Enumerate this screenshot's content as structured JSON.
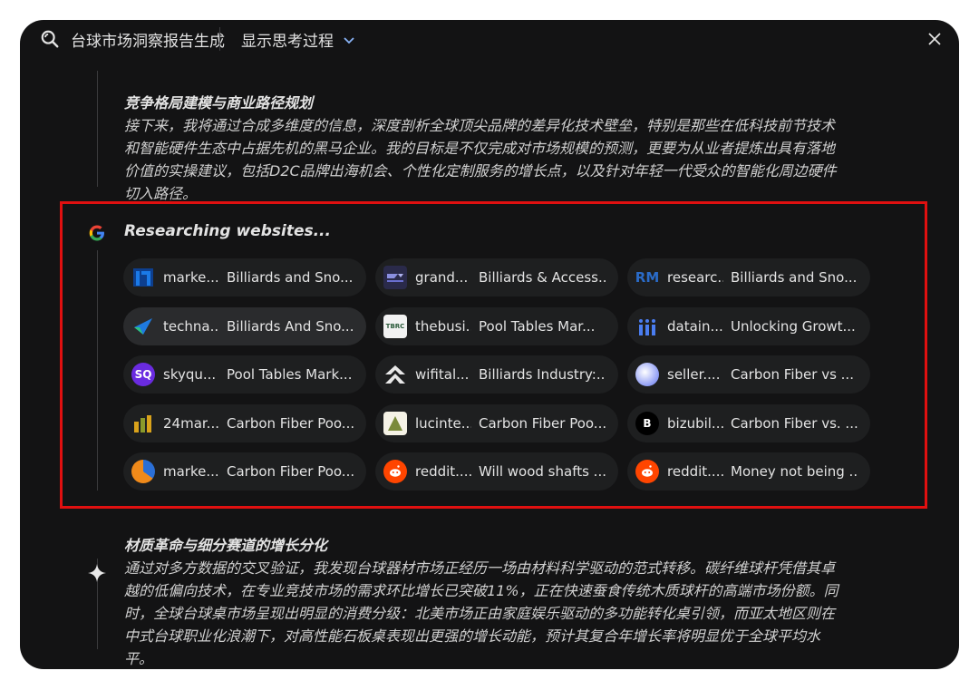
{
  "header": {
    "app_title": "台球市场洞察报告生成",
    "thinking_toggle": "显示思考过程",
    "close_label": "×"
  },
  "section1": {
    "title": "竞争格局建模与商业路径规划",
    "lines": [
      "接下来，我将通过合成多维度的信息，深度剖析全球顶尖品牌的差异化技术壁垒，特别是那些在低科技前节技术",
      "和智能硬件生态中占据先机的黑马企业。我的目标是不仅完成对市场规模的预测，更要为从业者提炼出具有落地",
      "价值的实操建议，包括D2C品牌出海机会、个性化定制服务的增长点，以及针对年轻一代受众的智能化周边硬件",
      "切入路径。"
    ]
  },
  "research": {
    "label": "Researching websites...",
    "chips": [
      {
        "site": "marke...",
        "title": "Billiards and Sno...",
        "icon": "bar-logo-icon",
        "color": "#2b6fd6"
      },
      {
        "site": "grand...",
        "title": "Billiards & Access...",
        "icon": "grand-logo-icon",
        "color": "#4a4fd6"
      },
      {
        "site": "researc...",
        "title": "Billiards and Sno...",
        "icon": "rm-logo-icon",
        "color": "#2a6bc8",
        "text": "RM"
      },
      {
        "site": "techna...",
        "title": "Billiards And Sno...",
        "icon": "techna-logo-icon",
        "color": "#1f7ae0"
      },
      {
        "site": "thebusi...",
        "title": "Pool Tables Mar...",
        "icon": "tbrc-logo-icon",
        "color": "#e8e8e8",
        "text": "TBRC"
      },
      {
        "site": "datain...",
        "title": "Unlocking Growt...",
        "icon": "datain-logo-icon",
        "color": "#4a7df0"
      },
      {
        "site": "skyqu...",
        "title": "Pool Tables Mark...",
        "icon": "sq-logo-icon",
        "color": "#6a2be0",
        "text": "SQ"
      },
      {
        "site": "wifital...",
        "title": "Billiards Industry:...",
        "icon": "wifital-logo-icon",
        "color": "#e8e8e8"
      },
      {
        "site": "seller....",
        "title": "Carbon Fiber vs ...",
        "icon": "globe-icon",
        "color": "#aab4ff"
      },
      {
        "site": "24mar...",
        "title": "Carbon Fiber Poo...",
        "icon": "24mar-logo-icon",
        "color": "#d9a21b"
      },
      {
        "site": "lucinte...",
        "title": "Carbon Fiber Poo...",
        "icon": "lucintel-logo-icon",
        "color": "#7a8a3a"
      },
      {
        "site": "bizubil...",
        "title": "Carbon Fiber vs. ...",
        "icon": "b-logo-icon",
        "color": "#111111",
        "text": "B"
      },
      {
        "site": "marke...",
        "title": "Carbon Fiber Poo...",
        "icon": "pie-logo-icon",
        "color": "#f08a1a"
      },
      {
        "site": "reddit....",
        "title": "Will wood shafts ...",
        "icon": "reddit-icon",
        "color": "#ff4500"
      },
      {
        "site": "reddit....",
        "title": "Money not being ...",
        "icon": "reddit-icon",
        "color": "#ff4500"
      }
    ]
  },
  "section2": {
    "title": "材质革命与细分赛道的增长分化",
    "lines": [
      "通过对多方数据的交叉验证，我发现台球器材市场正经历一场由材料科学驱动的范式转移。碳纤维球杆凭借其卓",
      "越的低偏向技术，在专业竞技市场的需求环比增长已突破11%，正在快速蚕食传统木质球杆的高端市场份额。同",
      "时，全球台球桌市场呈现出明显的消费分级：北美市场正由家庭娱乐驱动的多功能转化桌引领，而亚太地区则在",
      "中式台球职业化浪潮下，对高性能石板桌表现出更强的增长动能，预计其复合年增长率将明显优于全球平均水",
      "平。"
    ]
  },
  "colors": {
    "accent_red": "#e01010",
    "background": "#131314",
    "chip": "#1e1f20"
  }
}
